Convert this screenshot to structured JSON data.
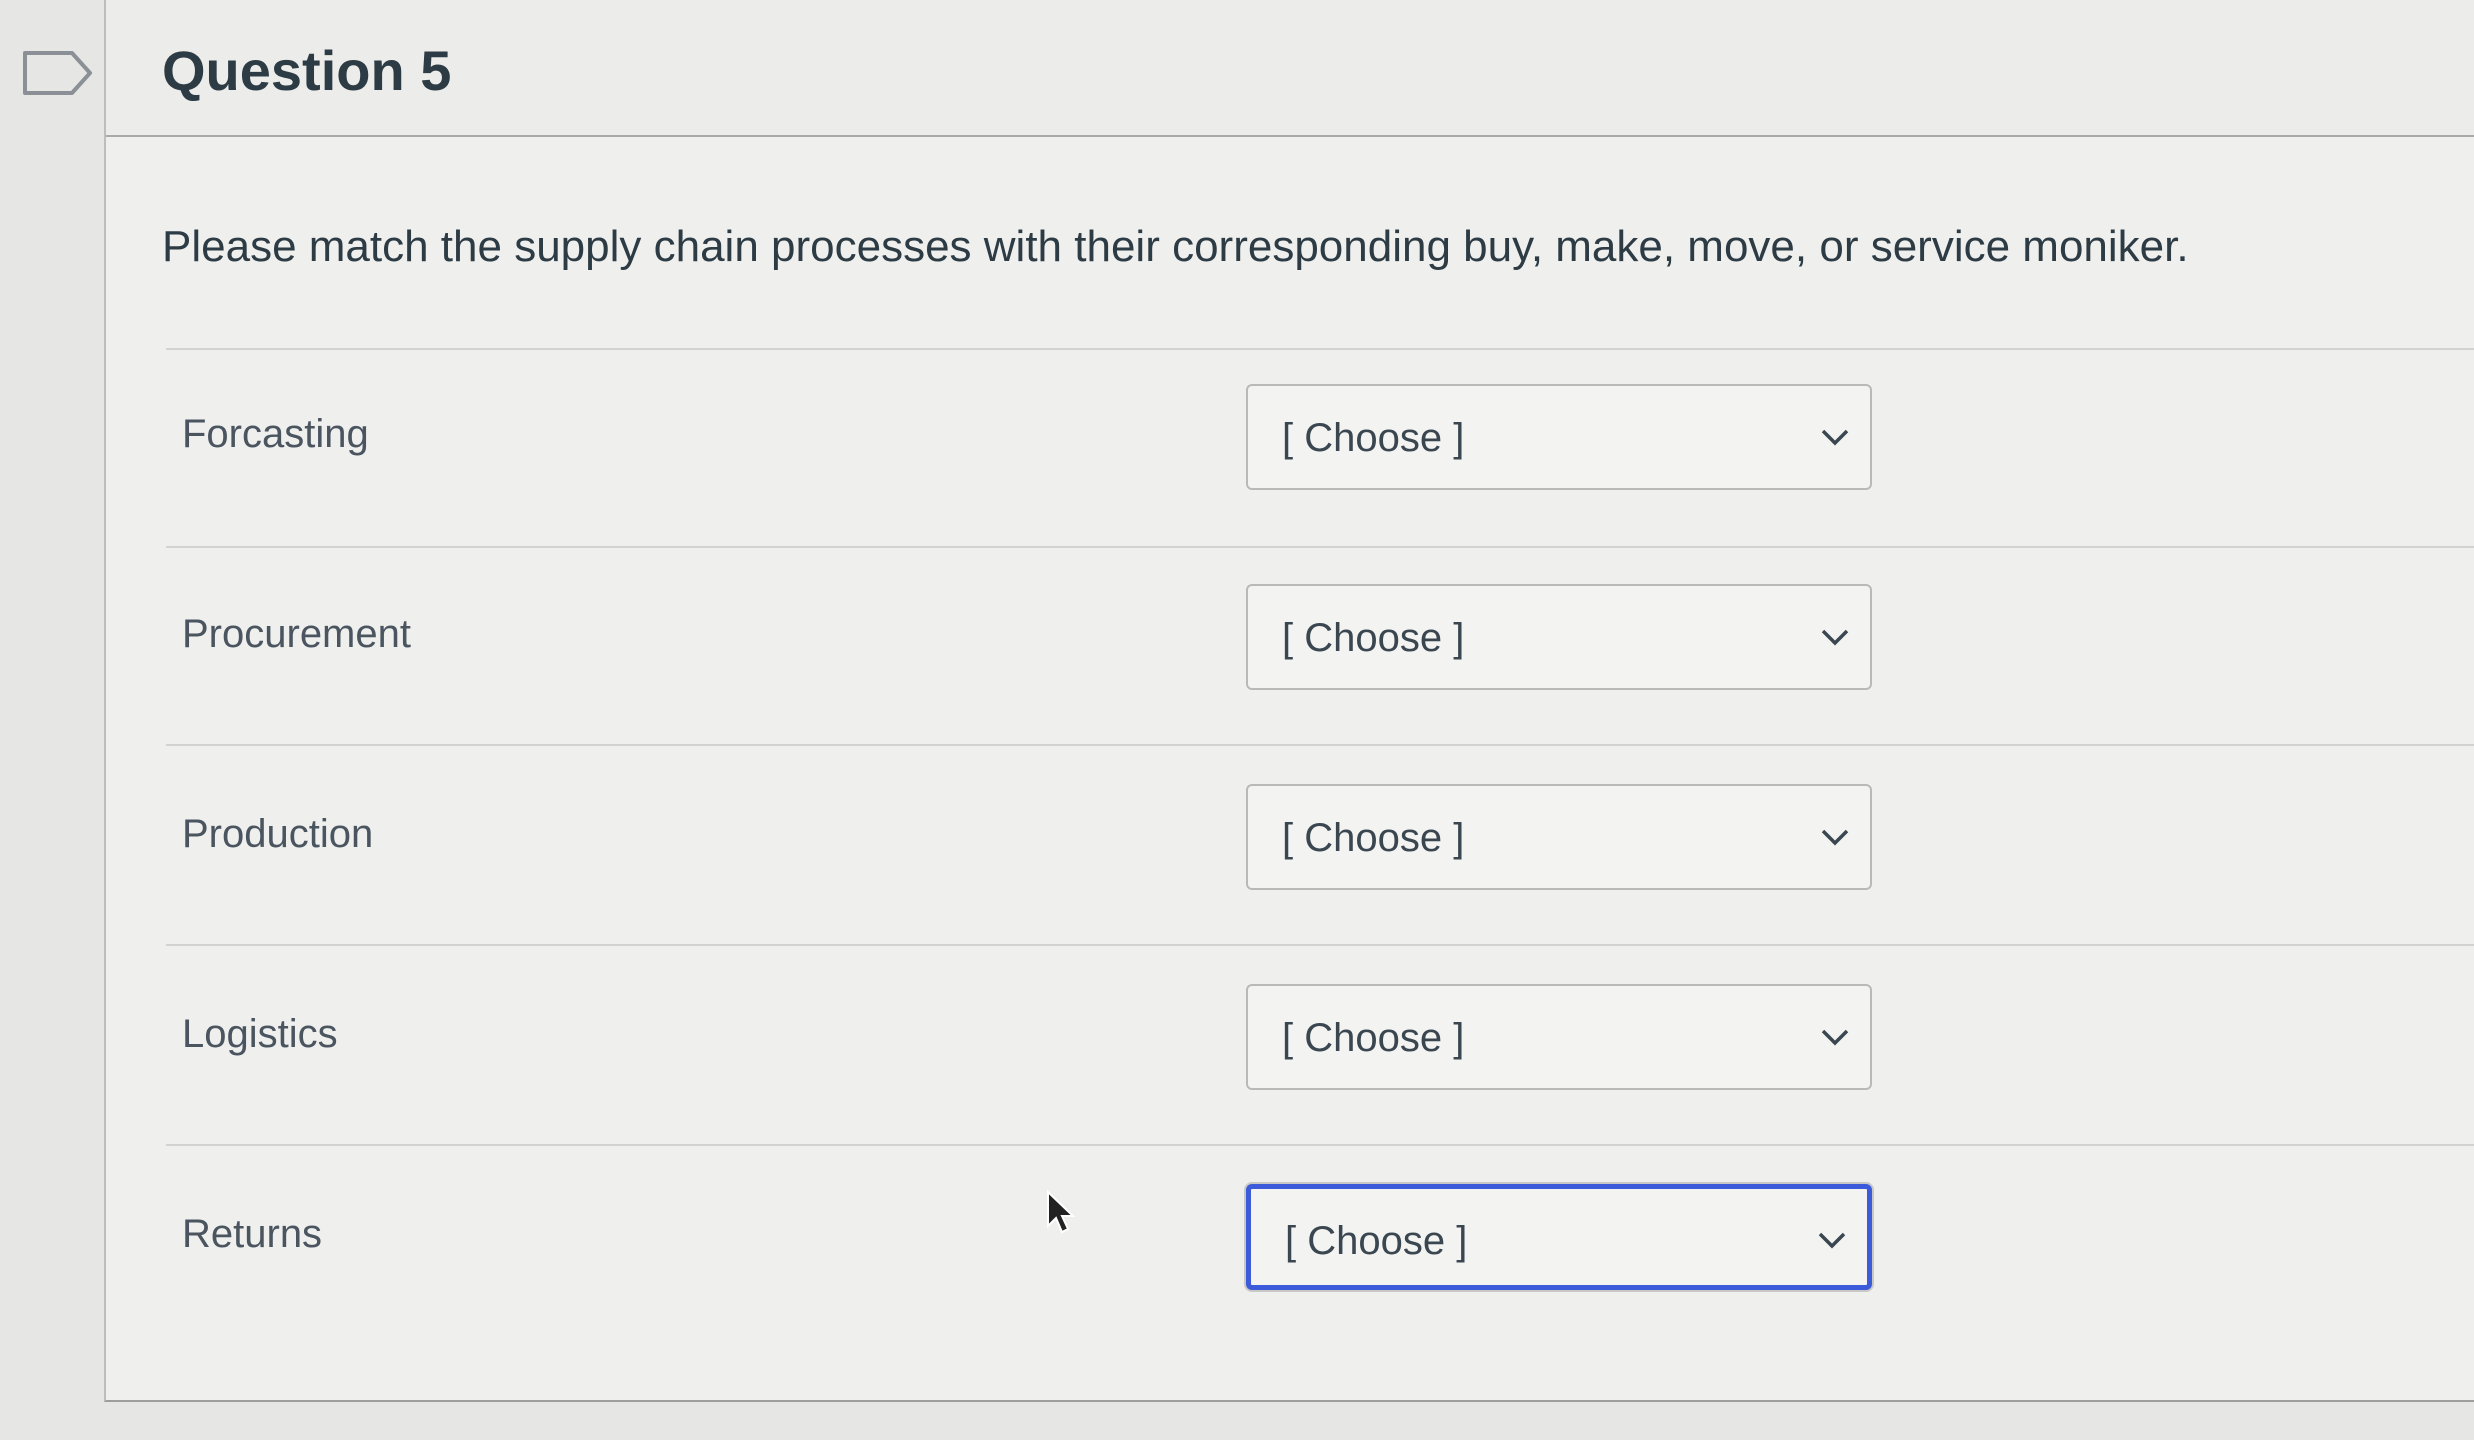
{
  "question": {
    "title": "Question 5",
    "prompt": "Please match the supply chain processes with their corresponding buy, make, move, or service moniker."
  },
  "rows": [
    {
      "label": "Forcasting",
      "select_value": "[ Choose ]"
    },
    {
      "label": "Procurement",
      "select_value": "[ Choose ]"
    },
    {
      "label": "Production",
      "select_value": "[ Choose ]"
    },
    {
      "label": "Logistics",
      "select_value": "[ Choose ]"
    },
    {
      "label": "Returns",
      "select_value": "[ Choose ]"
    }
  ],
  "icons": {
    "flag": "flag-outline-icon",
    "chevron": "chevron-down-icon",
    "cursor": "mouse-pointer-icon"
  },
  "colors": {
    "focus_border": "#3b5bdb",
    "text": "#2d3b45"
  }
}
